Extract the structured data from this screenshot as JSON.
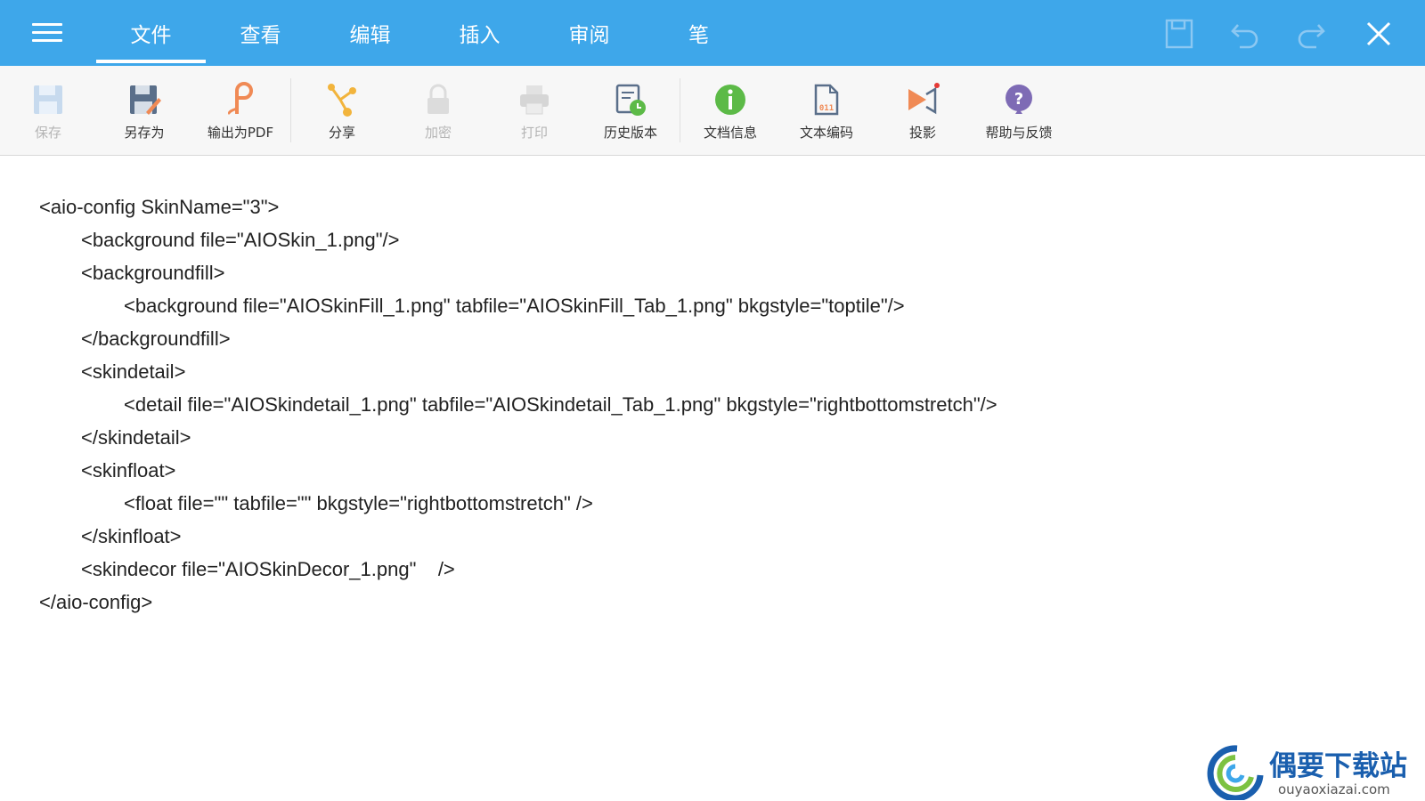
{
  "menubar": {
    "tabs": [
      {
        "label": "文件",
        "active": true
      },
      {
        "label": "查看"
      },
      {
        "label": "编辑"
      },
      {
        "label": "插入"
      },
      {
        "label": "审阅"
      },
      {
        "label": "笔"
      }
    ],
    "actions": [
      "save-icon",
      "undo-icon",
      "redo-icon",
      "close-icon"
    ]
  },
  "ribbon": {
    "items": [
      {
        "label": "保存",
        "icon": "floppy-disk-icon",
        "disabled": true
      },
      {
        "label": "另存为",
        "icon": "save-as-icon"
      },
      {
        "label": "输出为PDF",
        "icon": "pdf-export-icon"
      },
      {
        "label": "分享",
        "icon": "share-icon"
      },
      {
        "label": "加密",
        "icon": "lock-icon",
        "disabled": true
      },
      {
        "label": "打印",
        "icon": "printer-icon",
        "disabled": true
      },
      {
        "label": "历史版本",
        "icon": "history-icon"
      },
      {
        "label": "文档信息",
        "icon": "info-icon"
      },
      {
        "label": "文本编码",
        "icon": "text-encoding-icon"
      },
      {
        "label": "投影",
        "icon": "projection-icon"
      },
      {
        "label": "帮助与反馈",
        "icon": "help-icon"
      }
    ]
  },
  "document": {
    "lines": [
      "<aio-config SkinName=\"3\">",
      "<background file=\"AIOSkin_1.png\"/>",
      "<backgroundfill>",
      "<background file=\"AIOSkinFill_1.png\" tabfile=\"AIOSkinFill_Tab_1.png\" bkgstyle=\"toptile\"/>",
      "</backgroundfill>",
      "<skindetail>",
      "<detail file=\"AIOSkindetail_1.png\" tabfile=\"AIOSkindetail_Tab_1.png\" bkgstyle=\"rightbottomstretch\"/>",
      "</skindetail>",
      "<skinfloat>",
      "<float file=\"\" tabfile=\"\" bkgstyle=\"rightbottomstretch\" />",
      "</skinfloat>",
      "<skindecor file=\"AIOSkinDecor_1.png\"    />",
      "</aio-config>"
    ]
  },
  "watermark": {
    "title": "偶要下载站",
    "url": "ouyaoxiazai.com"
  },
  "colors": {
    "menubar": "#3ea7ea",
    "ribbon": "#f7f7f7",
    "text": "#222222",
    "disabled": "#b5b5b5",
    "pdf": "#f08a55",
    "share": "#f2b43c",
    "info": "#5cba47",
    "help": "#7e6bb5"
  }
}
